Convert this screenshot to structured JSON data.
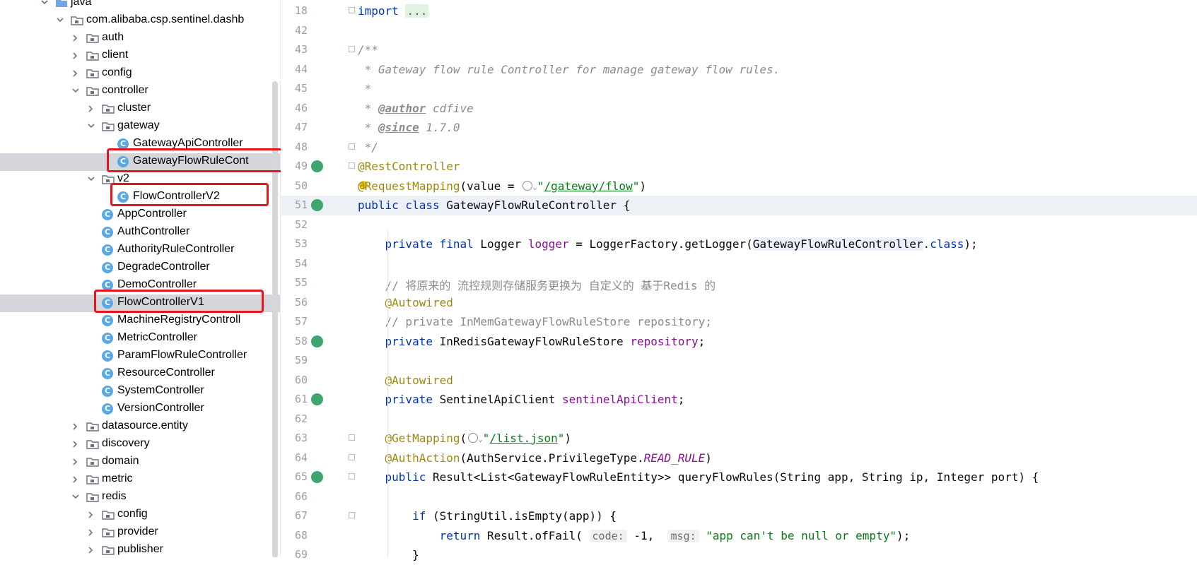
{
  "tree": {
    "items": [
      {
        "label": "java",
        "kind": "folder-src",
        "level": 0,
        "arrow": "down"
      },
      {
        "label": "com.alibaba.csp.sentinel.dashb",
        "kind": "package",
        "level": 1,
        "arrow": "down"
      },
      {
        "label": "auth",
        "kind": "package",
        "level": 2,
        "arrow": "right"
      },
      {
        "label": "client",
        "kind": "package",
        "level": 2,
        "arrow": "right"
      },
      {
        "label": "config",
        "kind": "package",
        "level": 2,
        "arrow": "right"
      },
      {
        "label": "controller",
        "kind": "package",
        "level": 2,
        "arrow": "down"
      },
      {
        "label": "cluster",
        "kind": "package",
        "level": 3,
        "arrow": "right"
      },
      {
        "label": "gateway",
        "kind": "package",
        "level": 3,
        "arrow": "down"
      },
      {
        "label": "GatewayApiController",
        "kind": "class",
        "level": 4
      },
      {
        "label": "GatewayFlowRuleCont",
        "kind": "class",
        "level": 4,
        "selected": true
      },
      {
        "label": "v2",
        "kind": "package",
        "level": 3,
        "arrow": "down"
      },
      {
        "label": "FlowControllerV2",
        "kind": "class",
        "level": 4
      },
      {
        "label": "AppController",
        "kind": "class",
        "level": 3
      },
      {
        "label": "AuthController",
        "kind": "class",
        "level": 3
      },
      {
        "label": "AuthorityRuleController",
        "kind": "class",
        "level": 3
      },
      {
        "label": "DegradeController",
        "kind": "class",
        "level": 3
      },
      {
        "label": "DemoController",
        "kind": "class",
        "level": 3
      },
      {
        "label": "FlowControllerV1",
        "kind": "class",
        "level": 3,
        "selected": true
      },
      {
        "label": "MachineRegistryControll",
        "kind": "class",
        "level": 3
      },
      {
        "label": "MetricController",
        "kind": "class",
        "level": 3
      },
      {
        "label": "ParamFlowRuleController",
        "kind": "class",
        "level": 3
      },
      {
        "label": "ResourceController",
        "kind": "class",
        "level": 3
      },
      {
        "label": "SystemController",
        "kind": "class",
        "level": 3
      },
      {
        "label": "VersionController",
        "kind": "class",
        "level": 3
      },
      {
        "label": "datasource.entity",
        "kind": "package",
        "level": 2,
        "arrow": "right"
      },
      {
        "label": "discovery",
        "kind": "package",
        "level": 2,
        "arrow": "right"
      },
      {
        "label": "domain",
        "kind": "package",
        "level": 2,
        "arrow": "right"
      },
      {
        "label": "metric",
        "kind": "package",
        "level": 2,
        "arrow": "right"
      },
      {
        "label": "redis",
        "kind": "package",
        "level": 2,
        "arrow": "down"
      },
      {
        "label": "config",
        "kind": "package",
        "level": 3,
        "arrow": "right"
      },
      {
        "label": "provider",
        "kind": "package",
        "level": 3,
        "arrow": "right"
      },
      {
        "label": "publisher",
        "kind": "package",
        "level": 3,
        "arrow": "right"
      }
    ],
    "class_icon_letter": "C"
  },
  "editor": {
    "current_line": "51",
    "lines": [
      {
        "no": "18",
        "fold": true,
        "spans": [
          [
            "kw",
            "import "
          ],
          [
            "fold-text",
            "..."
          ]
        ]
      },
      {
        "no": "42",
        "spans": []
      },
      {
        "no": "43",
        "fold": true,
        "spans": [
          [
            "cmt",
            "/**"
          ]
        ]
      },
      {
        "no": "44",
        "spans": [
          [
            "cmt",
            " * Gateway flow rule Controller for manage gateway flow rules."
          ]
        ]
      },
      {
        "no": "45",
        "spans": [
          [
            "cmt",
            " *"
          ]
        ]
      },
      {
        "no": "46",
        "spans": [
          [
            "cmt",
            " * "
          ],
          [
            "tag",
            "@author"
          ],
          [
            "cmt",
            " cdfive"
          ]
        ]
      },
      {
        "no": "47",
        "spans": [
          [
            "cmt",
            " * "
          ],
          [
            "tag",
            "@since"
          ],
          [
            "cmt",
            " 1.7.0"
          ]
        ]
      },
      {
        "no": "48",
        "fold": true,
        "spans": [
          [
            "cmt",
            " */"
          ]
        ]
      },
      {
        "no": "49",
        "gutter": "bean",
        "fold": true,
        "spans": [
          [
            "ann",
            "@RestController"
          ]
        ]
      },
      {
        "no": "50",
        "bulb": true,
        "spans": [
          [
            "ann",
            "@RequestMapping"
          ],
          [
            "",
            "(value = "
          ],
          [
            "globe",
            ""
          ],
          [
            "chev",
            "⌄"
          ],
          [
            "str",
            "\""
          ],
          [
            "strlink",
            "/gateway/flow"
          ],
          [
            "str",
            "\""
          ],
          [
            "",
            ")"
          ]
        ]
      },
      {
        "no": "51",
        "gutter": "bean",
        "current": true,
        "spans": [
          [
            "kw",
            "public class "
          ],
          [
            "hl-class",
            "GatewayFlowRuleController"
          ],
          [
            "",
            " {"
          ]
        ]
      },
      {
        "no": "52",
        "spans": []
      },
      {
        "no": "53",
        "spans": [
          [
            "",
            "    "
          ],
          [
            "kw",
            "private final "
          ],
          [
            "",
            "Logger "
          ],
          [
            "field",
            "logger"
          ],
          [
            "",
            " = LoggerFactory.getLogger("
          ],
          [
            "hl-class",
            "GatewayFlowRuleController"
          ],
          [
            "",
            "."
          ],
          [
            "kw",
            "class"
          ],
          [
            "",
            ");"
          ]
        ]
      },
      {
        "no": "54",
        "spans": []
      },
      {
        "no": "55",
        "spans": [
          [
            "",
            "    "
          ],
          [
            "cmt-plain",
            "// 将原来的 流控规则存储服务更换为 自定义的 基于Redis 的"
          ]
        ]
      },
      {
        "no": "56",
        "spans": [
          [
            "",
            "    "
          ],
          [
            "ann",
            "@Autowired"
          ]
        ]
      },
      {
        "no": "57",
        "spans": [
          [
            "",
            "    "
          ],
          [
            "cmt-plain",
            "// private InMemGatewayFlowRuleStore repository;"
          ]
        ]
      },
      {
        "no": "58",
        "gutter": "inject",
        "spans": [
          [
            "",
            "    "
          ],
          [
            "kw",
            "private "
          ],
          [
            "",
            "InRedisGatewayFlowRuleStore "
          ],
          [
            "field",
            "repository"
          ],
          [
            "",
            ";"
          ]
        ]
      },
      {
        "no": "59",
        "spans": []
      },
      {
        "no": "60",
        "spans": [
          [
            "",
            "    "
          ],
          [
            "ann",
            "@Autowired"
          ]
        ]
      },
      {
        "no": "61",
        "gutter": "inject",
        "spans": [
          [
            "",
            "    "
          ],
          [
            "kw",
            "private "
          ],
          [
            "",
            "SentinelApiClient "
          ],
          [
            "field",
            "sentinelApiClient"
          ],
          [
            "",
            ";"
          ]
        ]
      },
      {
        "no": "62",
        "spans": []
      },
      {
        "no": "63",
        "fold": true,
        "spans": [
          [
            "",
            "    "
          ],
          [
            "ann",
            "@GetMapping"
          ],
          [
            "",
            "("
          ],
          [
            "globe",
            ""
          ],
          [
            "chev",
            "⌄"
          ],
          [
            "str",
            "\""
          ],
          [
            "strlink",
            "/list.json"
          ],
          [
            "str",
            "\""
          ],
          [
            "",
            ")"
          ]
        ]
      },
      {
        "no": "64",
        "fold": true,
        "spans": [
          [
            "",
            "    "
          ],
          [
            "ann",
            "@AuthAction"
          ],
          [
            "",
            "(AuthService.PrivilegeType."
          ],
          [
            "static",
            "READ_RULE"
          ],
          [
            "",
            ")"
          ]
        ]
      },
      {
        "no": "65",
        "gutter": "web",
        "fold": true,
        "spans": [
          [
            "",
            "    "
          ],
          [
            "kw",
            "public "
          ],
          [
            "",
            "Result<List<GatewayFlowRuleEntity>> queryFlowRules(String app, String ip, Integer port) {"
          ]
        ]
      },
      {
        "no": "66",
        "spans": []
      },
      {
        "no": "67",
        "fold": true,
        "spans": [
          [
            "",
            "        "
          ],
          [
            "kw",
            "if "
          ],
          [
            "",
            "(StringUtil.isEmpty(app)) {"
          ]
        ]
      },
      {
        "no": "68",
        "spans": [
          [
            "",
            "            "
          ],
          [
            "kw",
            "return "
          ],
          [
            "",
            "Result.ofFail( "
          ],
          [
            "hint",
            "code:"
          ],
          [
            "",
            " -1,  "
          ],
          [
            "hint",
            "msg:"
          ],
          [
            "str",
            " \"app can't be null or empty\""
          ],
          [
            "",
            ");"
          ]
        ]
      },
      {
        "no": "69",
        "spans": [
          [
            "",
            "        }"
          ]
        ]
      }
    ]
  }
}
